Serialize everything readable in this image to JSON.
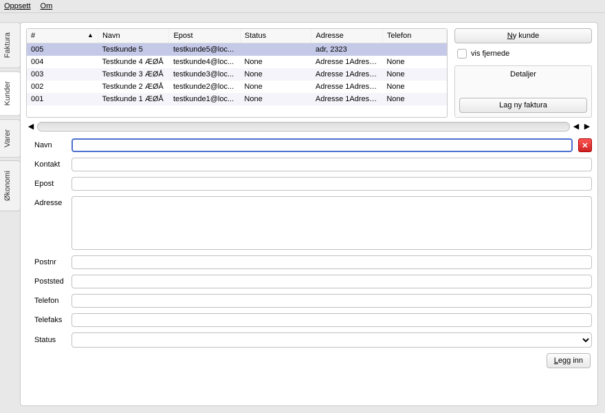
{
  "menu": {
    "oppsett": "Oppsett",
    "om": "Om"
  },
  "tabs": {
    "faktura": "Faktura",
    "kunder": "Kunder",
    "varer": "Varer",
    "okonomi": "Økonomi"
  },
  "table": {
    "headers": {
      "num": "#",
      "navn": "Navn",
      "epost": "Epost",
      "status": "Status",
      "adresse": "Adresse",
      "telefon": "Telefon"
    },
    "rows": [
      {
        "num": "005",
        "navn": "Testkunde 5",
        "epost": "testkunde5@loc...",
        "status": "",
        "adresse": "adr,  2323",
        "telefon": ""
      },
      {
        "num": "004",
        "navn": "Testkunde 4 ÆØÅ",
        "epost": "testkunde4@loc...",
        "status": "None",
        "adresse": "Adresse 1Adress...",
        "telefon": "None"
      },
      {
        "num": "003",
        "navn": "Testkunde 3 ÆØÅ",
        "epost": "testkunde3@loc...",
        "status": "None",
        "adresse": "Adresse 1Adress...",
        "telefon": "None"
      },
      {
        "num": "002",
        "navn": "Testkunde 2 ÆØÅ",
        "epost": "testkunde2@loc...",
        "status": "None",
        "adresse": "Adresse 1Adress...",
        "telefon": "None"
      },
      {
        "num": "001",
        "navn": "Testkunde 1 ÆØÅ",
        "epost": "testkunde1@loc...",
        "status": "None",
        "adresse": "Adresse 1Adress...",
        "telefon": "None"
      }
    ]
  },
  "side": {
    "ny_kunde": "Ny kunde",
    "vis_fjernede": "vis fjernede",
    "detaljer": "Detaljer",
    "lag_ny_faktura": "Lag ny faktura"
  },
  "form": {
    "labels": {
      "navn": "Navn",
      "kontakt": "Kontakt",
      "epost": "Epost",
      "adresse": "Adresse",
      "postnr": "Postnr",
      "poststed": "Poststed",
      "telefon": "Telefon",
      "telefaks": "Telefaks",
      "status": "Status"
    },
    "legg_inn": "Legg inn"
  }
}
